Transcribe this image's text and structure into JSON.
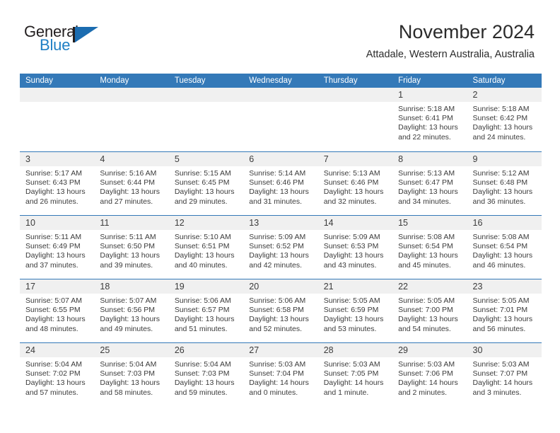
{
  "brand": {
    "name_part1": "General",
    "name_part2": "Blue",
    "logo_icon": "general-blue-triangle-logo"
  },
  "header": {
    "title": "November 2024",
    "subtitle": "Attadale, Western Australia, Australia"
  },
  "colors": {
    "header_blue": "#3479b8",
    "brand_blue": "#1f7fc4",
    "day_band_gray": "#f0f0f0",
    "text": "#3b3b3b"
  },
  "weekdays": [
    "Sunday",
    "Monday",
    "Tuesday",
    "Wednesday",
    "Thursday",
    "Friday",
    "Saturday"
  ],
  "weeks": [
    [
      {
        "empty": true
      },
      {
        "empty": true
      },
      {
        "empty": true
      },
      {
        "empty": true
      },
      {
        "empty": true
      },
      {
        "day": "1",
        "sunrise": "Sunrise: 5:18 AM",
        "sunset": "Sunset: 6:41 PM",
        "daylight1": "Daylight: 13 hours",
        "daylight2": "and 22 minutes."
      },
      {
        "day": "2",
        "sunrise": "Sunrise: 5:18 AM",
        "sunset": "Sunset: 6:42 PM",
        "daylight1": "Daylight: 13 hours",
        "daylight2": "and 24 minutes."
      }
    ],
    [
      {
        "day": "3",
        "sunrise": "Sunrise: 5:17 AM",
        "sunset": "Sunset: 6:43 PM",
        "daylight1": "Daylight: 13 hours",
        "daylight2": "and 26 minutes."
      },
      {
        "day": "4",
        "sunrise": "Sunrise: 5:16 AM",
        "sunset": "Sunset: 6:44 PM",
        "daylight1": "Daylight: 13 hours",
        "daylight2": "and 27 minutes."
      },
      {
        "day": "5",
        "sunrise": "Sunrise: 5:15 AM",
        "sunset": "Sunset: 6:45 PM",
        "daylight1": "Daylight: 13 hours",
        "daylight2": "and 29 minutes."
      },
      {
        "day": "6",
        "sunrise": "Sunrise: 5:14 AM",
        "sunset": "Sunset: 6:46 PM",
        "daylight1": "Daylight: 13 hours",
        "daylight2": "and 31 minutes."
      },
      {
        "day": "7",
        "sunrise": "Sunrise: 5:13 AM",
        "sunset": "Sunset: 6:46 PM",
        "daylight1": "Daylight: 13 hours",
        "daylight2": "and 32 minutes."
      },
      {
        "day": "8",
        "sunrise": "Sunrise: 5:13 AM",
        "sunset": "Sunset: 6:47 PM",
        "daylight1": "Daylight: 13 hours",
        "daylight2": "and 34 minutes."
      },
      {
        "day": "9",
        "sunrise": "Sunrise: 5:12 AM",
        "sunset": "Sunset: 6:48 PM",
        "daylight1": "Daylight: 13 hours",
        "daylight2": "and 36 minutes."
      }
    ],
    [
      {
        "day": "10",
        "sunrise": "Sunrise: 5:11 AM",
        "sunset": "Sunset: 6:49 PM",
        "daylight1": "Daylight: 13 hours",
        "daylight2": "and 37 minutes."
      },
      {
        "day": "11",
        "sunrise": "Sunrise: 5:11 AM",
        "sunset": "Sunset: 6:50 PM",
        "daylight1": "Daylight: 13 hours",
        "daylight2": "and 39 minutes."
      },
      {
        "day": "12",
        "sunrise": "Sunrise: 5:10 AM",
        "sunset": "Sunset: 6:51 PM",
        "daylight1": "Daylight: 13 hours",
        "daylight2": "and 40 minutes."
      },
      {
        "day": "13",
        "sunrise": "Sunrise: 5:09 AM",
        "sunset": "Sunset: 6:52 PM",
        "daylight1": "Daylight: 13 hours",
        "daylight2": "and 42 minutes."
      },
      {
        "day": "14",
        "sunrise": "Sunrise: 5:09 AM",
        "sunset": "Sunset: 6:53 PM",
        "daylight1": "Daylight: 13 hours",
        "daylight2": "and 43 minutes."
      },
      {
        "day": "15",
        "sunrise": "Sunrise: 5:08 AM",
        "sunset": "Sunset: 6:54 PM",
        "daylight1": "Daylight: 13 hours",
        "daylight2": "and 45 minutes."
      },
      {
        "day": "16",
        "sunrise": "Sunrise: 5:08 AM",
        "sunset": "Sunset: 6:54 PM",
        "daylight1": "Daylight: 13 hours",
        "daylight2": "and 46 minutes."
      }
    ],
    [
      {
        "day": "17",
        "sunrise": "Sunrise: 5:07 AM",
        "sunset": "Sunset: 6:55 PM",
        "daylight1": "Daylight: 13 hours",
        "daylight2": "and 48 minutes."
      },
      {
        "day": "18",
        "sunrise": "Sunrise: 5:07 AM",
        "sunset": "Sunset: 6:56 PM",
        "daylight1": "Daylight: 13 hours",
        "daylight2": "and 49 minutes."
      },
      {
        "day": "19",
        "sunrise": "Sunrise: 5:06 AM",
        "sunset": "Sunset: 6:57 PM",
        "daylight1": "Daylight: 13 hours",
        "daylight2": "and 51 minutes."
      },
      {
        "day": "20",
        "sunrise": "Sunrise: 5:06 AM",
        "sunset": "Sunset: 6:58 PM",
        "daylight1": "Daylight: 13 hours",
        "daylight2": "and 52 minutes."
      },
      {
        "day": "21",
        "sunrise": "Sunrise: 5:05 AM",
        "sunset": "Sunset: 6:59 PM",
        "daylight1": "Daylight: 13 hours",
        "daylight2": "and 53 minutes."
      },
      {
        "day": "22",
        "sunrise": "Sunrise: 5:05 AM",
        "sunset": "Sunset: 7:00 PM",
        "daylight1": "Daylight: 13 hours",
        "daylight2": "and 54 minutes."
      },
      {
        "day": "23",
        "sunrise": "Sunrise: 5:05 AM",
        "sunset": "Sunset: 7:01 PM",
        "daylight1": "Daylight: 13 hours",
        "daylight2": "and 56 minutes."
      }
    ],
    [
      {
        "day": "24",
        "sunrise": "Sunrise: 5:04 AM",
        "sunset": "Sunset: 7:02 PM",
        "daylight1": "Daylight: 13 hours",
        "daylight2": "and 57 minutes."
      },
      {
        "day": "25",
        "sunrise": "Sunrise: 5:04 AM",
        "sunset": "Sunset: 7:03 PM",
        "daylight1": "Daylight: 13 hours",
        "daylight2": "and 58 minutes."
      },
      {
        "day": "26",
        "sunrise": "Sunrise: 5:04 AM",
        "sunset": "Sunset: 7:03 PM",
        "daylight1": "Daylight: 13 hours",
        "daylight2": "and 59 minutes."
      },
      {
        "day": "27",
        "sunrise": "Sunrise: 5:03 AM",
        "sunset": "Sunset: 7:04 PM",
        "daylight1": "Daylight: 14 hours",
        "daylight2": "and 0 minutes."
      },
      {
        "day": "28",
        "sunrise": "Sunrise: 5:03 AM",
        "sunset": "Sunset: 7:05 PM",
        "daylight1": "Daylight: 14 hours",
        "daylight2": "and 1 minute."
      },
      {
        "day": "29",
        "sunrise": "Sunrise: 5:03 AM",
        "sunset": "Sunset: 7:06 PM",
        "daylight1": "Daylight: 14 hours",
        "daylight2": "and 2 minutes."
      },
      {
        "day": "30",
        "sunrise": "Sunrise: 5:03 AM",
        "sunset": "Sunset: 7:07 PM",
        "daylight1": "Daylight: 14 hours",
        "daylight2": "and 3 minutes."
      }
    ]
  ]
}
